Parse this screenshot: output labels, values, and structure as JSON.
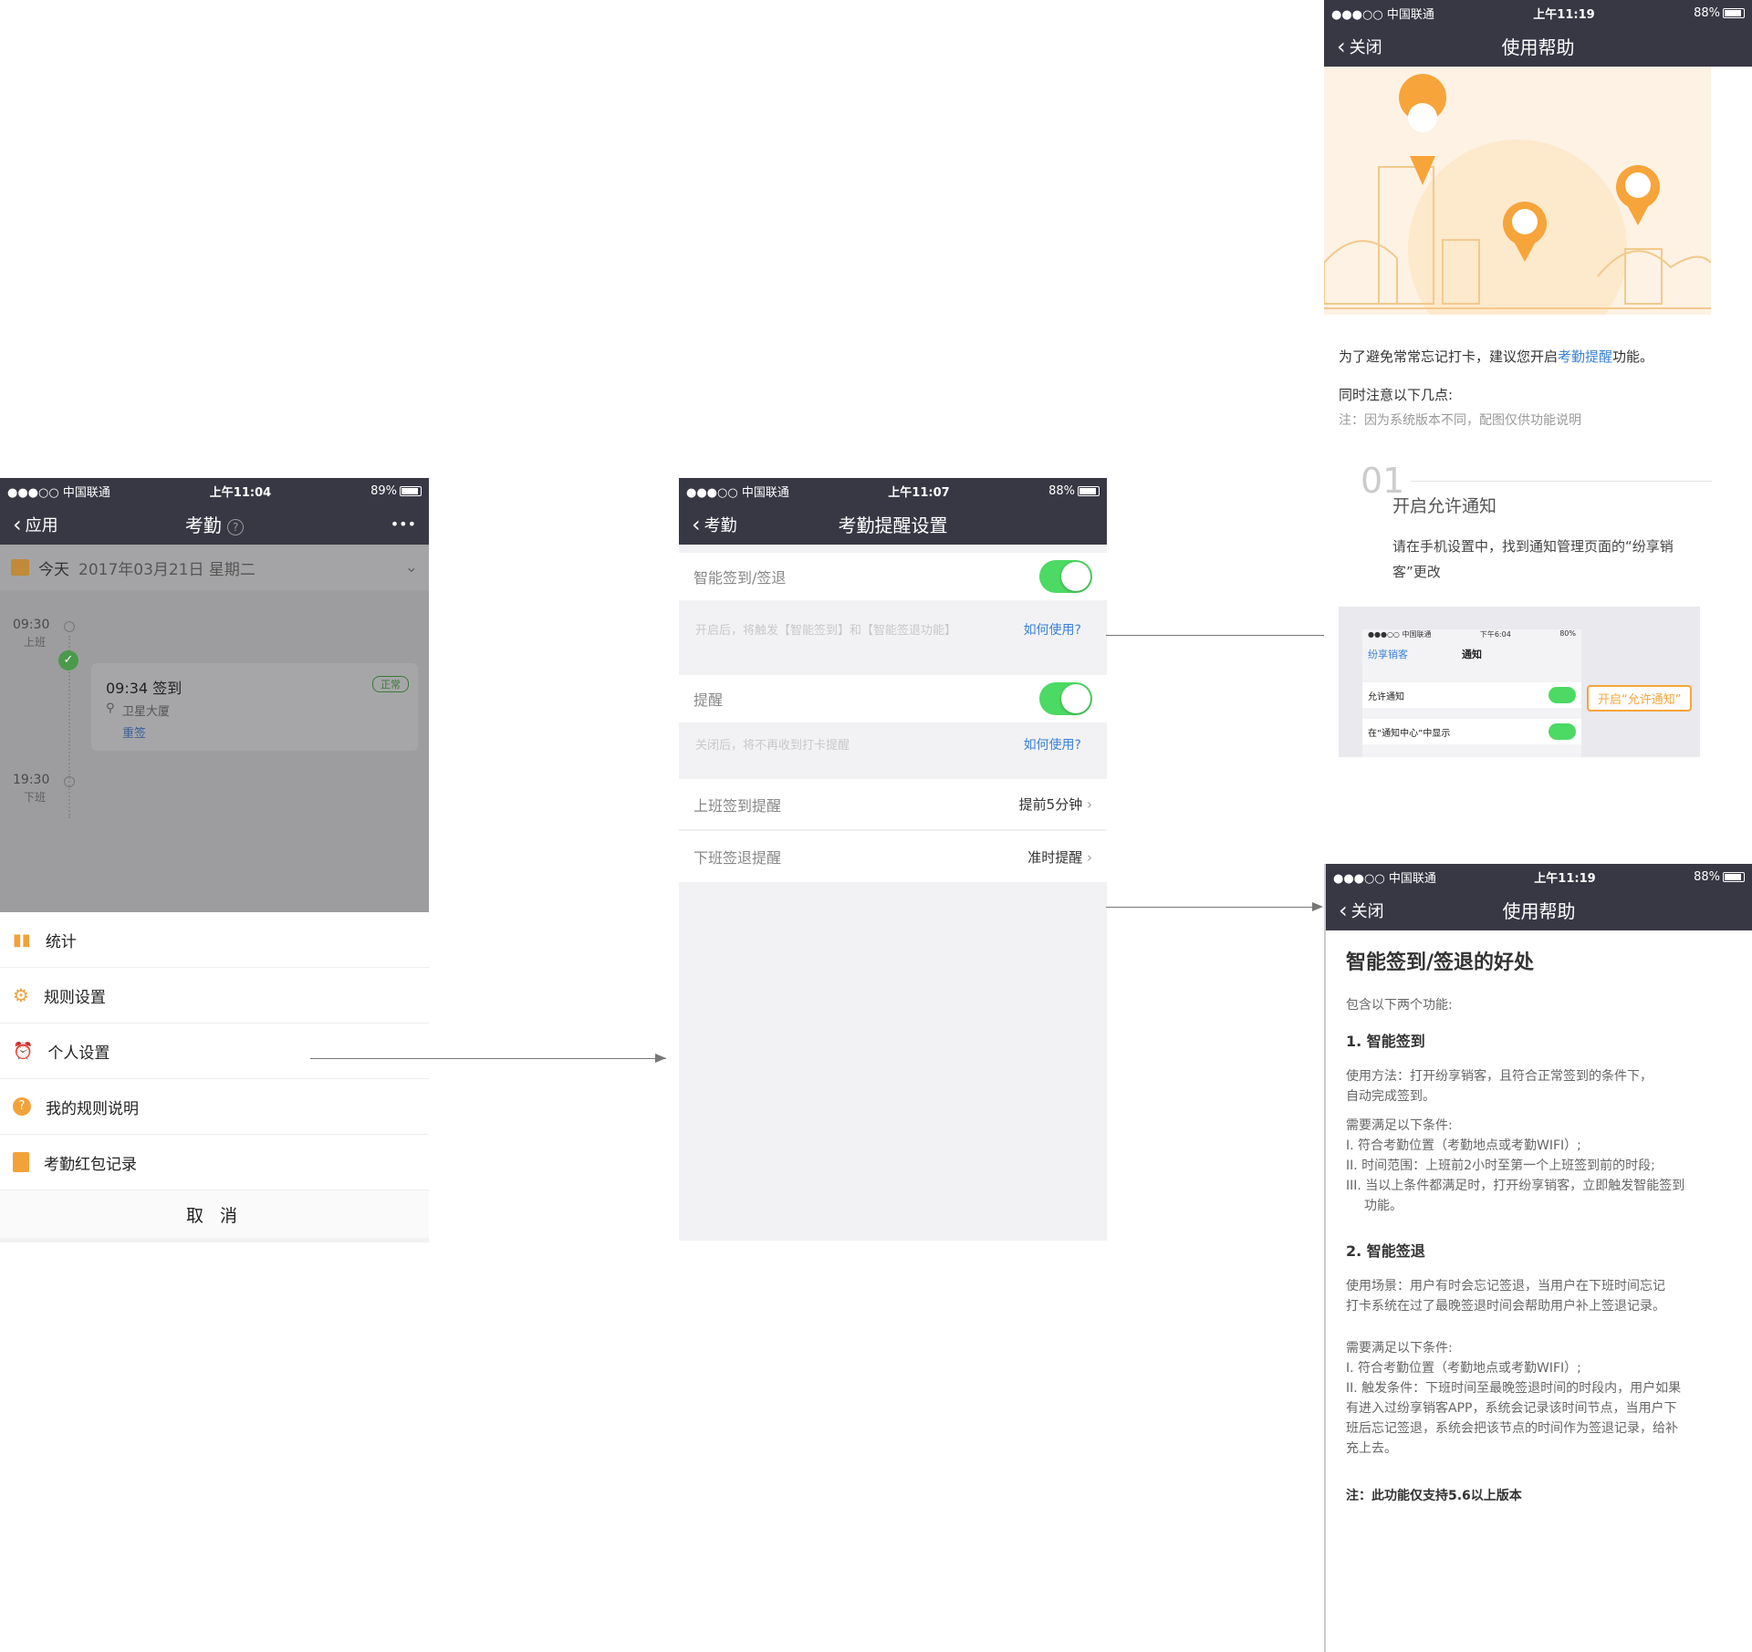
{
  "p1": {
    "status": {
      "carrier": "●●●○○ 中国联通",
      "time": "上午11:04",
      "battery": "89%"
    },
    "nav": {
      "back": "应用",
      "title": "考勤",
      "more": "•••"
    },
    "date": {
      "today": "今天",
      "date": "2017年03月21日 星期二"
    },
    "timeline": {
      "t1": "09:30",
      "t1_sub": "上班",
      "t2": "19:30",
      "t2_sub": "下班"
    },
    "record": {
      "time_label": "09:34 签到",
      "location": "卫星大厦",
      "resign": "重签",
      "badge": "正常"
    },
    "menu": [
      {
        "label": "统计",
        "icon": "bar-chart-icon"
      },
      {
        "label": "规则设置",
        "icon": "gear-icon"
      },
      {
        "label": "个人设置",
        "icon": "alarm-icon"
      },
      {
        "label": "我的规则说明",
        "icon": "question-icon"
      },
      {
        "label": "考勤红包记录",
        "icon": "red-packet-icon"
      }
    ],
    "cancel": "取 消"
  },
  "p2": {
    "status": {
      "carrier": "●●●○○ 中国联通",
      "time": "上午11:07",
      "battery": "88%"
    },
    "nav": {
      "back": "考勤",
      "title": "考勤提醒设置"
    },
    "smart": {
      "label": "智能签到/签退",
      "hint": "开启后，将触发【智能签到】和【智能签退功能】",
      "link": "如何使用?"
    },
    "remind": {
      "label": "提醒",
      "hint": "关闭后，将不再收到打卡提醒",
      "link": "如何使用?"
    },
    "rows": [
      {
        "label": "上班签到提醒",
        "value": "提前5分钟"
      },
      {
        "label": "下班签退提醒",
        "value": "准时提醒"
      }
    ]
  },
  "p3": {
    "status": {
      "carrier": "●●●○○ 中国联通",
      "time": "上午11:19",
      "battery": "88%"
    },
    "nav": {
      "back": "关闭",
      "title": "使用帮助"
    },
    "intro_pre": "为了避免常常忘记打卡，建议您开启",
    "intro_link": "考勤提醒",
    "intro_post": "功能。",
    "note_title": "同时注意以下几点:",
    "note": "注：因为系统版本不同，配图仅供功能说明",
    "step_num": "01",
    "step_title": "开启允许通知",
    "step_desc": "请在手机设置中，找到通知管理页面的“纷享销客”更改",
    "mini": {
      "status_time": "下午6:04",
      "status_batt": "80%",
      "back": "纷享销客",
      "title": "通知",
      "row1": "允许通知",
      "row2": "在“通知中心”中显示",
      "callout": "开启“允许通知”"
    }
  },
  "p4": {
    "status": {
      "carrier": "●●●○○ 中国联通",
      "time": "上午11:19",
      "battery": "88%"
    },
    "nav": {
      "back": "关闭",
      "title": "使用帮助"
    },
    "heading": "智能签到/签退的好处",
    "sub": "包含以下两个功能:",
    "s1_title": "1. 智能签到",
    "s1_use": "使用方法：打开纷享销客，且符合正常签到的条件下，",
    "s1_use2": "自动完成签到。",
    "s1_need": "需要满足以下条件:",
    "s1_c1": "I. 符合考勤位置（考勤地点或考勤WIFI）;",
    "s1_c2": "II. 时间范围：上班前2小时至第一个上班签到前的时段;",
    "s1_c3": "III. 当以上条件都满足时，打开纷享销客，立即触发智能签到",
    "s1_c3b": "功能。",
    "s2_title": "2. 智能签退",
    "s2_use": "使用场景：用户有时会忘记签退，当用户在下班时间忘记",
    "s2_use2": "打卡系统在过了最晚签退时间会帮助用户补上签退记录。",
    "s2_need": "需要满足以下条件:",
    "s2_c1": "I. 符合考勤位置（考勤地点或考勤WIFI）;",
    "s2_c2": "II. 触发条件：下班时间至最晚签退时间的时段内，用户如果",
    "s2_c2b": "有进入过纷享销客APP，系统会记录该时间节点，当用户下",
    "s2_c2c": "班后忘记签退，系统会把该节点的时间作为签退记录，给补",
    "s2_c2d": "充上去。",
    "footnote": "注：此功能仅支持5.6以上版本"
  }
}
